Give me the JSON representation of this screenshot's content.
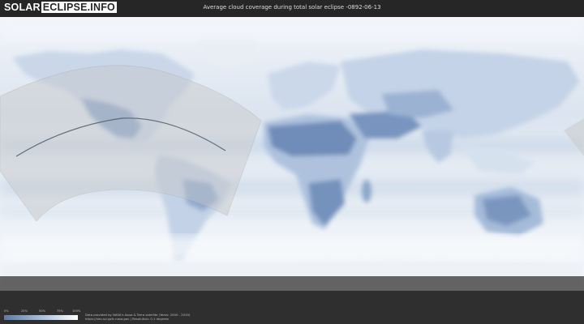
{
  "header": {
    "logo_part1": "SOLAR",
    "logo_part2": "ECLIPSE.INFO",
    "title": "Average cloud coverage during total solar eclipse -0892-06-13"
  },
  "legend": {
    "ticks": [
      "0%",
      "25%",
      "50%",
      "75%",
      "100%"
    ],
    "colors": [
      "#5e79a3",
      "#a8bdd8",
      "#ffffff"
    ]
  },
  "credits": {
    "line1": "Data provided by NASA's Aqua & Terra satellite (Years: 2000 - 2019)",
    "line2": "https://neo.sci.gsfc.nasa.gov | Resolution: 0.1 degrees"
  },
  "colors": {
    "ocean": "#dfe7f1",
    "land_clear": "#7f9bc3",
    "cloud": "#f4f7fb",
    "eclipse_band": "#c6c6c6",
    "central_line": "#505a66"
  }
}
